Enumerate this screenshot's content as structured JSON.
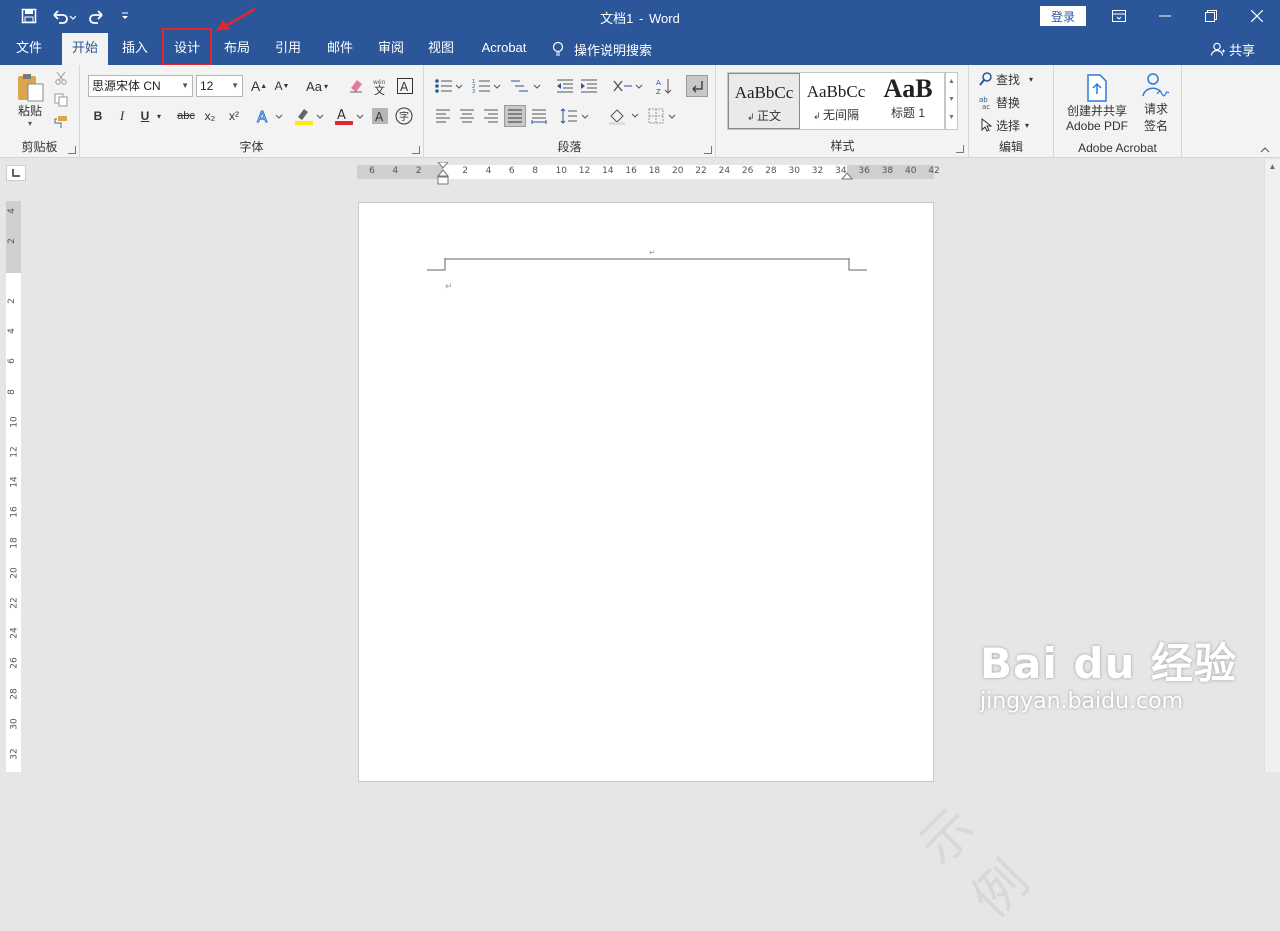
{
  "window": {
    "title_doc": "文档1",
    "title_sep": "-",
    "title_app": "Word",
    "login_label": "登录"
  },
  "tabs": [
    "文件",
    "开始",
    "插入",
    "设计",
    "布局",
    "引用",
    "邮件",
    "审阅",
    "视图",
    "Acrobat"
  ],
  "tell_me": "操作说明搜索",
  "share": "共享",
  "ribbon": {
    "clipboard": {
      "paste": "粘贴",
      "label": "剪贴板"
    },
    "font": {
      "name": "思源宋体 CN",
      "size": "12",
      "case": "Aa",
      "bold": "B",
      "italic": "I",
      "underline": "U",
      "strike": "abc",
      "sub": "x₂",
      "sup": "x²",
      "label": "字体"
    },
    "paragraph": {
      "label": "段落"
    },
    "styles": {
      "items": [
        {
          "preview": "AaBbCc",
          "name": "正文"
        },
        {
          "preview": "AaBbCc",
          "name": "无间隔"
        },
        {
          "preview": "AaB",
          "name": "标题 1"
        }
      ],
      "label": "样式"
    },
    "editing": {
      "find": "查找",
      "replace": "替换",
      "select": "选择",
      "label": "编辑"
    },
    "acrobat": {
      "create_line1": "创建并共享",
      "create_line2": "Adobe PDF",
      "sign_line1": "请求",
      "sign_line2": "签名",
      "label": "Adobe Acrobat"
    }
  },
  "ruler": {
    "h_left": [
      "6",
      "4",
      "2"
    ],
    "h_main": [
      "2",
      "4",
      "6",
      "8",
      "10",
      "12",
      "14",
      "16",
      "18",
      "20",
      "22",
      "24",
      "26",
      "28",
      "30",
      "32",
      "34"
    ],
    "h_right": [
      "36",
      "38",
      "40",
      "42"
    ],
    "v_top": [
      "4",
      "2"
    ],
    "v_main": [
      "2",
      "4",
      "6",
      "8",
      "10",
      "12",
      "14",
      "16",
      "18",
      "20",
      "22",
      "24",
      "26",
      "28",
      "30",
      "32"
    ]
  },
  "watermark": "示例",
  "baidu": {
    "logo": "Bai du 经验",
    "url": "jingyan.baidu.com"
  },
  "colors": {
    "brand": "#2b579a",
    "highlight": "#e0262e"
  }
}
